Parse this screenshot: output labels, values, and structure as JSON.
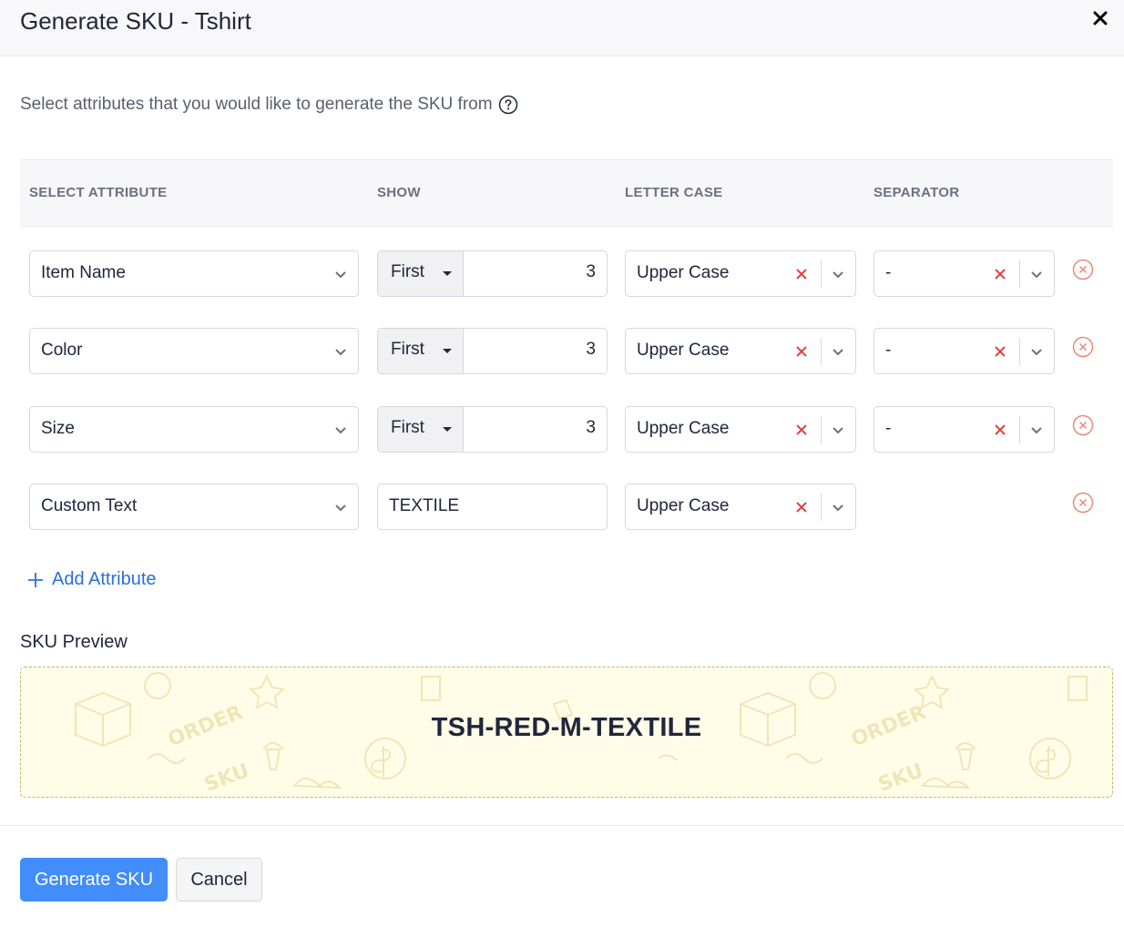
{
  "dialog": {
    "title": "Generate SKU - Tshirt",
    "subtitle": "Select attributes that you would like to generate the SKU from"
  },
  "table": {
    "headers": {
      "select_attribute": "SELECT ATTRIBUTE",
      "show": "SHOW",
      "letter_case": "LETTER CASE",
      "separator": "SEPARATOR"
    },
    "rows": [
      {
        "attribute": "Item Name",
        "show_mode": "First",
        "show_count": "3",
        "letter_case": "Upper Case",
        "separator": "-"
      },
      {
        "attribute": "Color",
        "show_mode": "First",
        "show_count": "3",
        "letter_case": "Upper Case",
        "separator": "-"
      },
      {
        "attribute": "Size",
        "show_mode": "First",
        "show_count": "3",
        "letter_case": "Upper Case",
        "separator": "-"
      },
      {
        "attribute": "Custom Text",
        "custom_text": "TEXTILE",
        "letter_case": "Upper Case"
      }
    ]
  },
  "add_attribute_label": "Add Attribute",
  "preview": {
    "label": "SKU Preview",
    "value": "TSH-RED-M-TEXTILE",
    "doodle_words": [
      "ORDER",
      "SKU",
      "ORDER",
      "SKU"
    ]
  },
  "footer": {
    "primary_label": "Generate SKU",
    "cancel_label": "Cancel"
  },
  "colors": {
    "accent": "#408dfb",
    "link": "#2b6fd6",
    "clear_x": "#e0433f",
    "remove_icon": "#e88a7a",
    "preview_bg": "#fffde8"
  }
}
